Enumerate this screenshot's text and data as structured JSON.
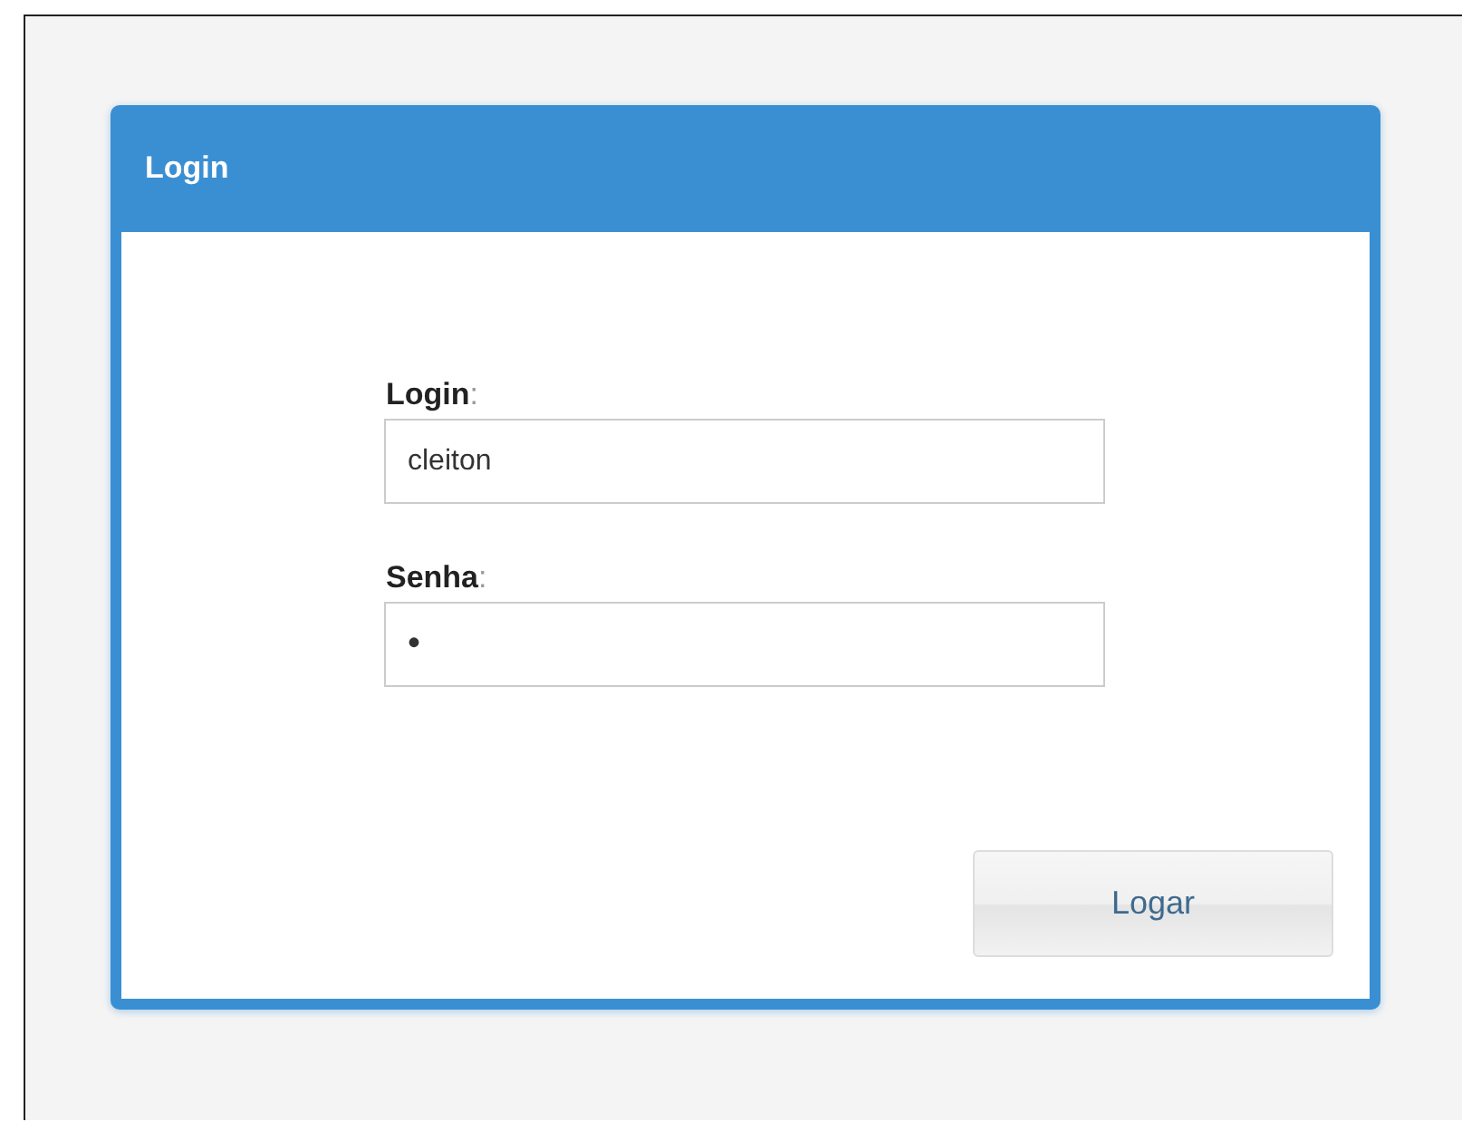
{
  "panel": {
    "title": "Login"
  },
  "fields": [
    {
      "label": "Login",
      "separator": ":",
      "value": "cleiton",
      "kind": "text"
    },
    {
      "label": "Senha",
      "separator": ":",
      "value": "•",
      "kind": "password"
    }
  ],
  "buttons": [
    "Logar"
  ]
}
